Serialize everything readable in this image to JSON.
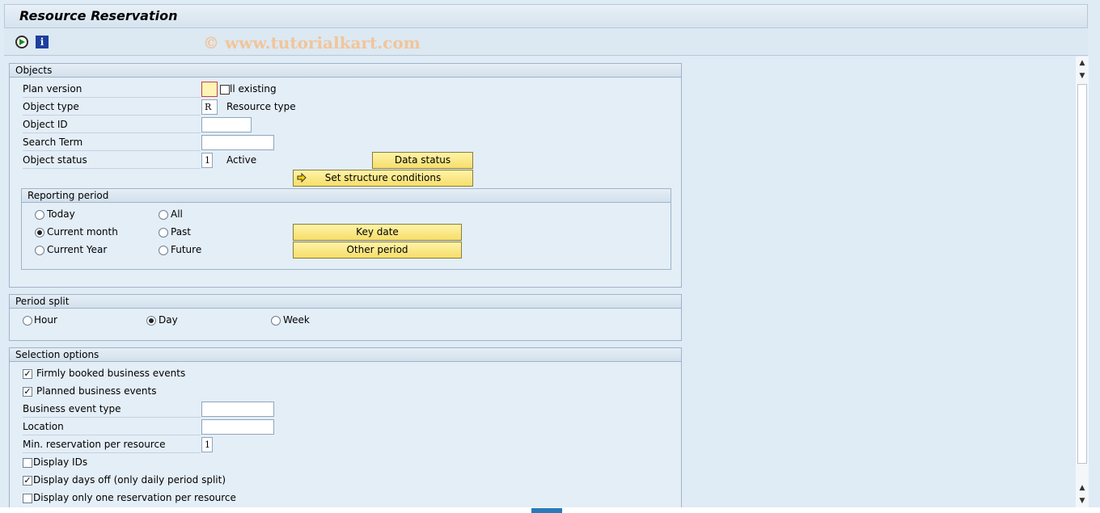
{
  "window": {
    "title": "Resource Reservation"
  },
  "watermark": "© www.tutorialkart.com",
  "objects": {
    "header": "Objects",
    "plan_version_label": "Plan version",
    "plan_version_value": "",
    "plan_version_text": "ll existing",
    "object_type_label": "Object type",
    "object_type_value": "R",
    "object_type_text": "Resource type",
    "object_id_label": "Object ID",
    "object_id_value": "",
    "search_term_label": "Search Term",
    "search_term_value": "",
    "object_status_label": "Object status",
    "object_status_value": "1",
    "object_status_text": "Active",
    "data_status_button": "Data status",
    "set_structure_button": "Set structure conditions"
  },
  "reporting_period": {
    "header": "Reporting period",
    "options": {
      "today": "Today",
      "all": "All",
      "current_month": "Current month",
      "past": "Past",
      "current_year": "Current Year",
      "future": "Future"
    },
    "selected": "current_month",
    "key_date_button": "Key date",
    "other_period_button": "Other period"
  },
  "period_split": {
    "header": "Period split",
    "hour": "Hour",
    "day": "Day",
    "week": "Week",
    "selected": "day"
  },
  "selection_options": {
    "header": "Selection options",
    "firmly_booked": {
      "label": "Firmly booked business events",
      "checked": true
    },
    "planned": {
      "label": "Planned business events",
      "checked": true
    },
    "business_event_type_label": "Business event type",
    "business_event_type_value": "",
    "location_label": "Location",
    "location_value": "",
    "min_reservation_label": "Min. reservation per resource",
    "min_reservation_value": "1",
    "display_ids": {
      "label": "Display IDs",
      "checked": false
    },
    "display_days_off": {
      "label": "Display days off (only daily period split)",
      "checked": true
    },
    "display_one_reservation": {
      "label": "Display only one reservation per resource",
      "checked": false
    }
  }
}
